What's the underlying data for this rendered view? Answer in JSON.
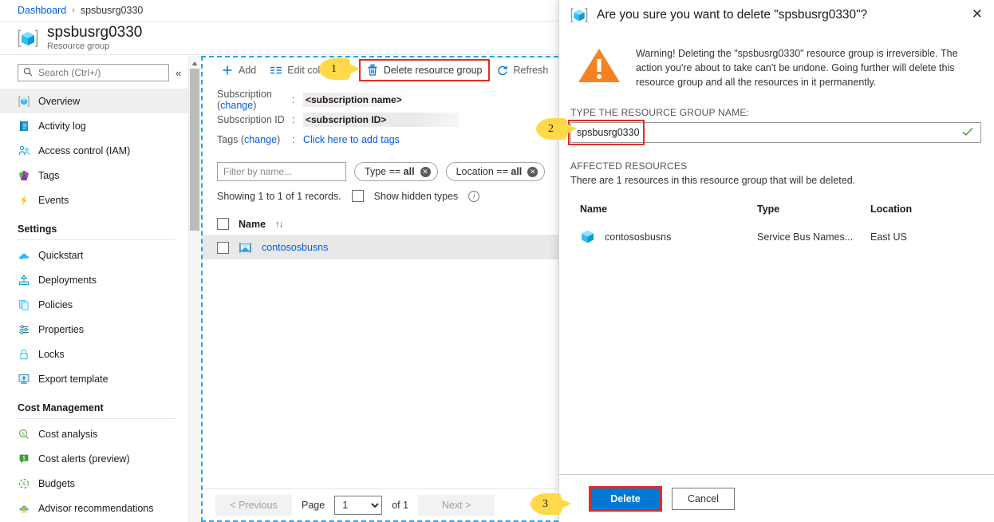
{
  "breadcrumb": {
    "root": "Dashboard",
    "separator": "›",
    "current": "spsbusrg0330"
  },
  "blade": {
    "title": "spsbusrg0330",
    "subtitle": "Resource group",
    "icon": "resource-group-cube-icon"
  },
  "sidebar": {
    "search": {
      "placeholder": "Search (Ctrl+/)",
      "value": "",
      "icon": "search-icon"
    },
    "collapse_label": "«",
    "items": [
      {
        "label": "Overview",
        "icon": "overview-icon",
        "active": true
      },
      {
        "label": "Activity log",
        "icon": "activity-log-icon"
      },
      {
        "label": "Access control (IAM)",
        "icon": "access-control-icon"
      },
      {
        "label": "Tags",
        "icon": "tags-icon"
      },
      {
        "label": "Events",
        "icon": "events-lightning-icon"
      }
    ],
    "groups": [
      {
        "label": "Settings",
        "items": [
          {
            "label": "Quickstart",
            "icon": "quickstart-cloud-icon"
          },
          {
            "label": "Deployments",
            "icon": "deployments-upload-icon"
          },
          {
            "label": "Policies",
            "icon": "policies-docs-icon"
          },
          {
            "label": "Properties",
            "icon": "properties-sliders-icon"
          },
          {
            "label": "Locks",
            "icon": "lock-icon"
          },
          {
            "label": "Export template",
            "icon": "export-template-icon"
          }
        ]
      },
      {
        "label": "Cost Management",
        "items": [
          {
            "label": "Cost analysis",
            "icon": "cost-analysis-icon"
          },
          {
            "label": "Cost alerts (preview)",
            "icon": "cost-alerts-icon"
          },
          {
            "label": "Budgets",
            "icon": "budgets-icon"
          },
          {
            "label": "Advisor recommendations",
            "icon": "advisor-icon"
          }
        ]
      }
    ]
  },
  "command_bar": {
    "items": [
      {
        "label": "Add",
        "icon": "plus-icon",
        "highlighted": false
      },
      {
        "label": "Edit columns",
        "icon": "edit-columns-icon",
        "highlighted": false
      },
      {
        "label": "Delete resource group",
        "icon": "trash-icon",
        "highlighted": true
      },
      {
        "label": "Refresh",
        "icon": "refresh-icon",
        "highlighted": false
      },
      {
        "label": "",
        "icon": "move-icon",
        "highlighted": false
      }
    ]
  },
  "properties": {
    "rows": [
      {
        "label": "Subscription",
        "change_link": "change",
        "colon": ":",
        "value": "<subscription name>",
        "redacted": "a"
      },
      {
        "label": "Subscription ID",
        "change_link": "",
        "colon": ":",
        "value": "<subscription ID>",
        "redacted": "b"
      },
      {
        "label": "Tags",
        "change_link": "change",
        "colon": ":",
        "value": "Click here to add tags",
        "redacted": "link"
      }
    ]
  },
  "filters": {
    "name_placeholder": "Filter by name...",
    "name_value": "",
    "pills": [
      {
        "prefix": "Type == ",
        "value": "all",
        "clear_icon": "clear-filter-icon"
      },
      {
        "prefix": "Location == ",
        "value": "all",
        "clear_icon": "clear-filter-icon"
      }
    ]
  },
  "records": {
    "summary": "Showing 1 to 1 of 1 records.",
    "show_hidden_label": "Show hidden types",
    "show_hidden_checked": false,
    "info_icon": "info-icon"
  },
  "grid": {
    "header": {
      "name": "Name",
      "sort_icon": "sort-arrows-icon",
      "sort_glyph": "↑↓"
    },
    "rows": [
      {
        "name": "contososbusns",
        "icon": "service-bus-namespace-icon",
        "selected": false
      }
    ]
  },
  "pager": {
    "previous": "< Previous",
    "page_label": "Page",
    "page_value": "1",
    "page_options": [
      "1"
    ],
    "of_label": "of 1",
    "next": "Next >"
  },
  "dialog": {
    "icon": "resource-group-cube-icon",
    "title": "Are you sure you want to delete \"spsbusrg0330\"?",
    "close_icon": "close-icon",
    "warning_icon": "warning-triangle-icon",
    "warning_text": "Warning! Deleting the \"spsbusrg0330\" resource group is irreversible. The action you're about to take can't be undone. Going further will delete this resource group and all the resources in it permanently.",
    "confirm_label": "TYPE THE RESOURCE GROUP NAME:",
    "confirm_value": "spsbusrg0330",
    "confirm_placeholder": "",
    "valid_icon": "green-check-icon",
    "affected_title": "AFFECTED RESOURCES",
    "affected_subtitle": "There are 1 resources in this resource group that will be deleted.",
    "table": {
      "columns": [
        "Name",
        "Type",
        "Location"
      ],
      "rows": [
        {
          "name": "contososbusns",
          "icon": "service-bus-cube-icon",
          "type": "Service Bus Names...",
          "location": "East US"
        }
      ]
    },
    "delete_label": "Delete",
    "cancel_label": "Cancel"
  },
  "callouts": [
    {
      "number": "1",
      "target": "delete-resource-group-command"
    },
    {
      "number": "2",
      "target": "confirm-name-input"
    },
    {
      "number": "3",
      "target": "delete-button"
    }
  ],
  "colors": {
    "accent": "#0078d4",
    "link": "#015cda",
    "highlight_red": "#e02c20",
    "callout_yellow": "#ffd94a",
    "warning_orange": "#f58220",
    "selection_blue": "#21a7e8",
    "valid_green": "#4d9c2d"
  }
}
